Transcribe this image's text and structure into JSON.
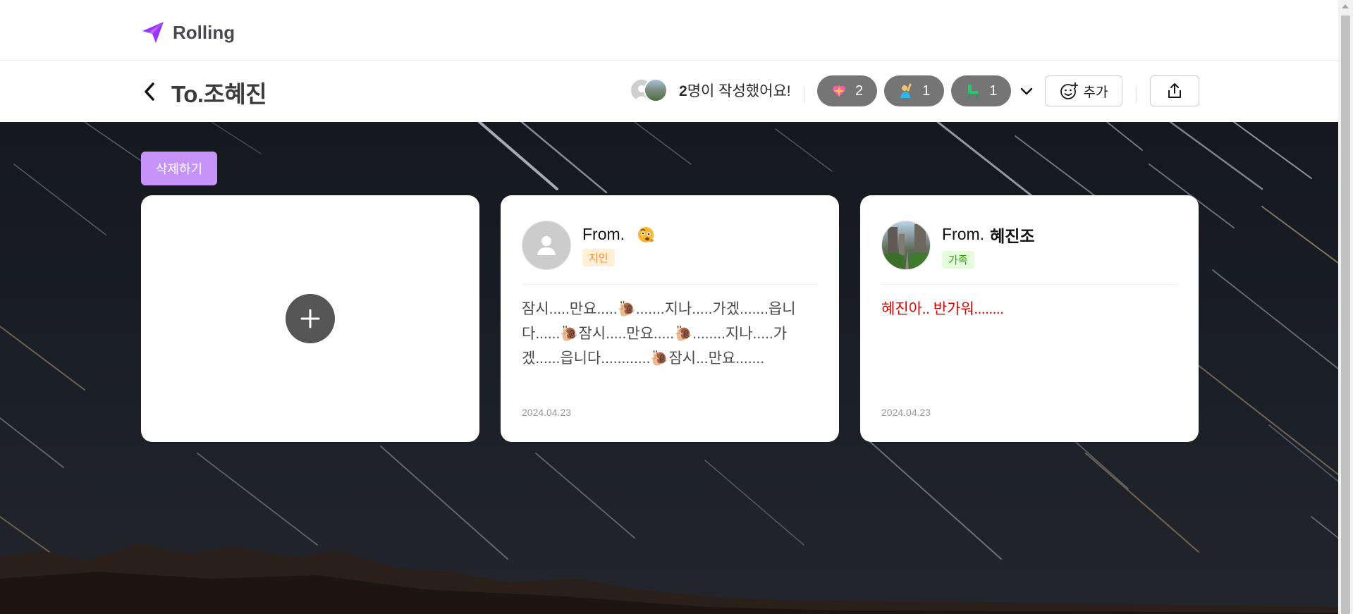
{
  "nav": {
    "logo_text": "Rolling"
  },
  "header": {
    "title": "To.조혜진",
    "writers_count": "2",
    "writers_suffix": "명이 작성했어요!",
    "reactions": [
      {
        "emoji": "sparkle-heart",
        "count": "2"
      },
      {
        "emoji": "person-raising-hand",
        "count": "1"
      },
      {
        "emoji": "green-chair",
        "count": "1"
      }
    ],
    "add_label": "추가"
  },
  "main": {
    "delete_label": "삭제하기",
    "cards": [
      {
        "from_label": "From.",
        "name": "",
        "name_emoji": "face-with-raised-eyebrow",
        "relation": "지인",
        "content": "잠시.....만요.....🐌.......지나.....가겠.......읍니다......🐌잠시.....만요.....🐌........지나.....가겠......읍니다............🐌잠시...만요.......",
        "date": "2024.04.23"
      },
      {
        "from_label": "From.",
        "name": "혜진조",
        "relation": "가족",
        "content": "혜진아.. 반가워........",
        "date": "2024.04.23"
      }
    ]
  },
  "colors": {
    "accent": "#c694f9",
    "reaction_bg": "#545454",
    "badge_acquaintance_bg": "#fff0d6",
    "badge_acquaintance_text": "#ff8832",
    "badge_family_bg": "#e4fbdc",
    "badge_family_text": "#2ba600",
    "message_red": "#e00000"
  }
}
